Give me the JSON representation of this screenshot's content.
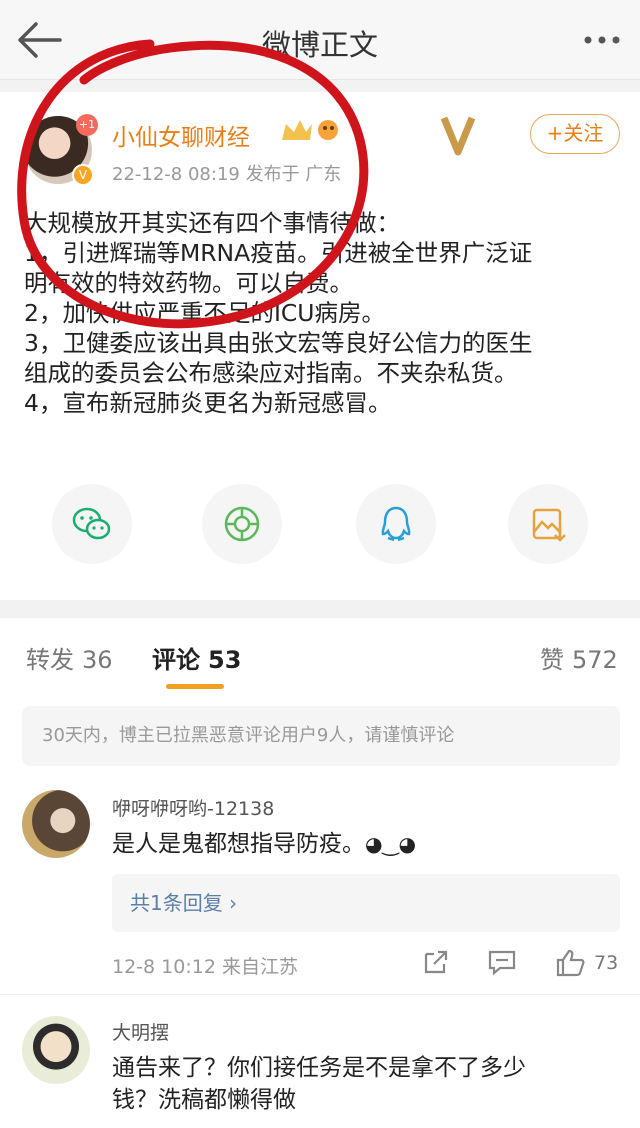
{
  "nav": {
    "title": "微博正文",
    "back_icon": "back-arrow-icon",
    "more_icon": "more-dots-icon"
  },
  "post": {
    "username": "小仙女聊财经",
    "avatar_badge": "+1",
    "verified_badge": "V",
    "meta": "22-12-8 08:19  发布于 广东",
    "follow_label": "+关注",
    "brand_badge": "V影",
    "lines": [
      "大规模放开其实还有四个事情待做：",
      "1，引进辉瑞等MRNA疫苗。引进被全世界广泛证",
      "明有效的特效药物。可以自费。",
      "2，加快供应严重不足的ICU病房。",
      "3，卫健委应该出具由张文宏等良好公信力的医生",
      "组成的委员会公布感染应对指南。不夹杂私货。",
      "4，宣布新冠肺炎更名为新冠感冒。"
    ],
    "share_icons": [
      "wechat-icon",
      "moments-icon",
      "qq-icon",
      "save-image-icon"
    ]
  },
  "tabs": {
    "repost": {
      "label": "转发",
      "count": "36"
    },
    "comment": {
      "label": "评论",
      "count": "53"
    },
    "like": {
      "label": "赞",
      "count": "572"
    }
  },
  "notice": "30天内，博主已拉黑恶意评论用户9人，请谨慎评论",
  "comments": [
    {
      "name": "咿呀咿呀哟-12138",
      "text": "是人是鬼都想指导防疫。",
      "reply_label": "共1条回复 ›",
      "meta": "12-8 10:12  来自江苏",
      "likes": "73"
    },
    {
      "name": "大明摆",
      "text_line1": "通告来了？你们接任务是不是拿不了多少",
      "text_line2": "钱？洗稿都懒得做"
    }
  ],
  "colors": {
    "accent": "#e8801a",
    "tab_underline": "#f0a020",
    "link": "#5a7fa8",
    "annotation_red": "#d0141c"
  }
}
